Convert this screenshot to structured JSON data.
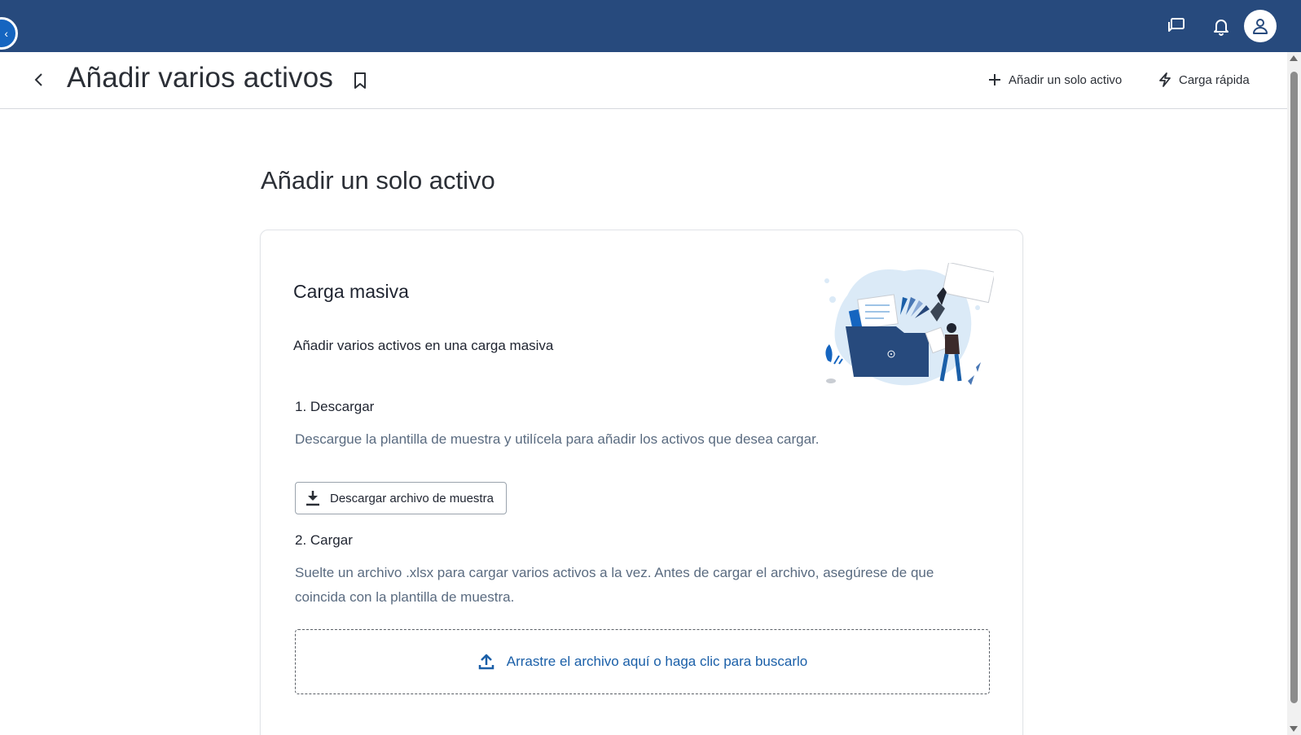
{
  "topbar": {
    "collapse_glyph": "‹",
    "icons": [
      "chat-icon",
      "bell-icon",
      "user-icon"
    ],
    "color": "#274a7d"
  },
  "header": {
    "title": "Añadir varios activos",
    "actions": [
      {
        "label": "Añadir un solo activo",
        "icon": "plus-icon"
      },
      {
        "label": "Carga rápida",
        "icon": "lightning-icon"
      }
    ]
  },
  "main": {
    "section_title": "Añadir un solo activo",
    "card": {
      "title": "Carga masiva",
      "subtitle": "Añadir varios activos en una carga masiva",
      "step1": {
        "title": "1. Descargar",
        "description": "Descargue la plantilla de muestra y utilícela para añadir los activos que desea cargar.",
        "button_label": "Descargar archivo de muestra"
      },
      "step2": {
        "title": "2. Cargar",
        "description": "Suelte un archivo .xlsx para cargar varios activos a la vez. Antes de cargar el archivo, asegúrese de que coincida con la plantilla de muestra.",
        "dropzone_label": "Arrastre el archivo aquí o haga clic para buscarlo"
      }
    }
  },
  "colors": {
    "accent": "#1a5fa8",
    "topbar": "#274a7d",
    "muted_text": "#5a6b80"
  }
}
